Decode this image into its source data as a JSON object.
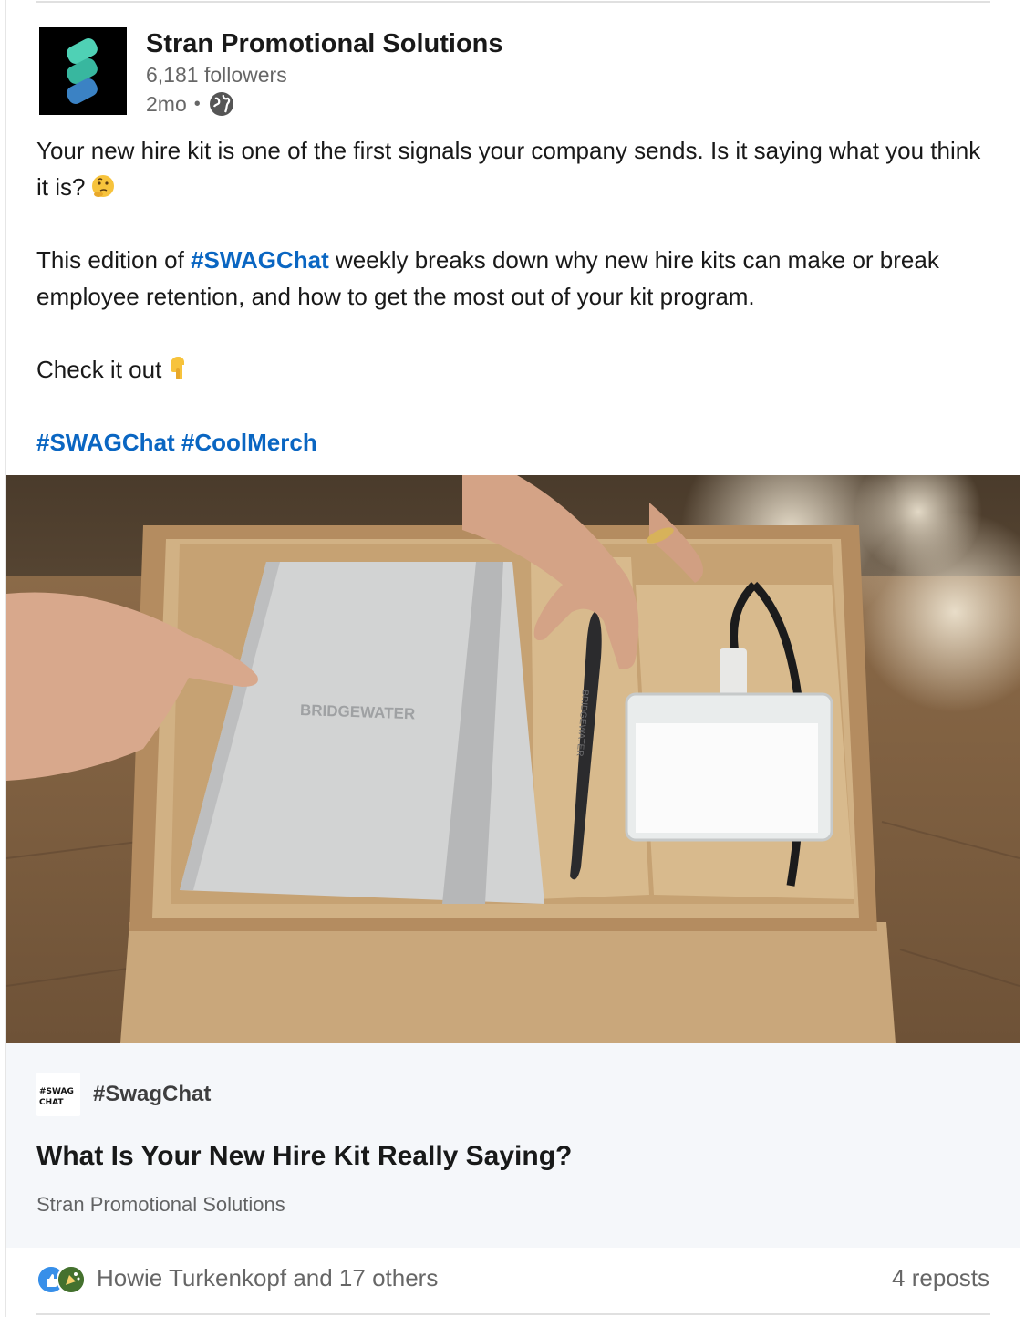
{
  "post": {
    "author": {
      "name": "Stran Promotional Solutions",
      "followers": "6,181 followers",
      "time": "2mo",
      "separator": "•",
      "visibility_icon": "globe-icon"
    },
    "text": {
      "p1_before": "Your new hire kit is one of the first signals your company sends. Is it saying what you think it is?",
      "p1_emoji": "thinking-face-emoji",
      "p2_before": "This edition of ",
      "p2_tag": "#SWAGChat",
      "p2_after": " weekly breaks down why new hire kits can make or break employee retention, and how to get the most out of your kit program.",
      "p3": "Check it out",
      "p3_emoji": "pointing-down-emoji",
      "tags": [
        "#SWAGChat",
        "#CoolMerch"
      ]
    },
    "image": {
      "notebook_brand": "BRIDGEWATER",
      "pen_brand": "BRIDGEWATER"
    },
    "link_preview": {
      "source_thumb_lines": [
        "#SWAG",
        "CHAT"
      ],
      "source_name": "#SwagChat",
      "title": "What Is Your New Hire Kit Really Saying?",
      "subtitle": "Stran Promotional Solutions"
    },
    "social": {
      "reactions_text": "Howie Turkenkopf and 17 others",
      "reposts": "4 reposts"
    }
  },
  "colors": {
    "link_blue": "#0a66c2",
    "logo_bg": "#000000",
    "logo_teal": "#4fd1b5",
    "logo_blue": "#3b82c4",
    "link_bar_bg": "#f5f7fa"
  }
}
